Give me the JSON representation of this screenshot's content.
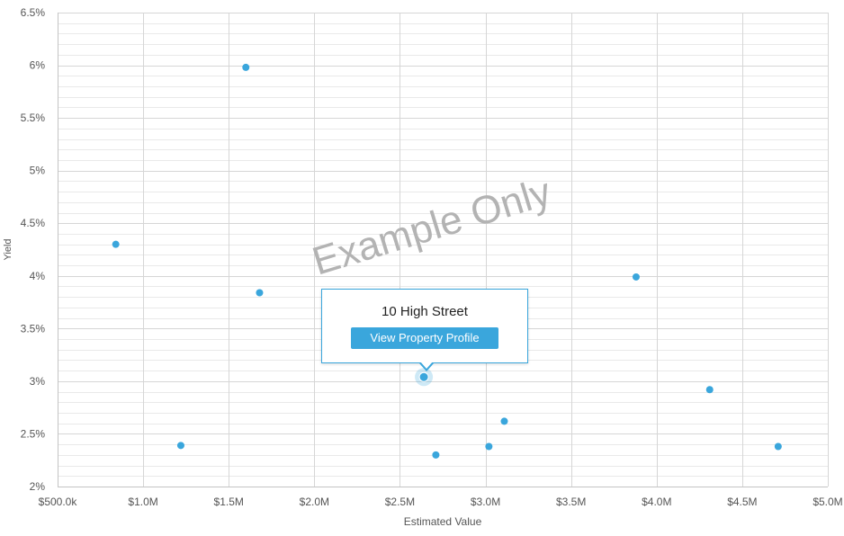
{
  "chart_data": {
    "type": "scatter",
    "xlabel": "Estimated Value",
    "ylabel": "Yield",
    "xlim": [
      500000,
      5000000
    ],
    "ylim": [
      2,
      6.5
    ],
    "x_ticks": [
      {
        "value": 500000,
        "label": "$500.0k"
      },
      {
        "value": 1000000,
        "label": "$1.0M"
      },
      {
        "value": 1500000,
        "label": "$1.5M"
      },
      {
        "value": 2000000,
        "label": "$2.0M"
      },
      {
        "value": 2500000,
        "label": "$2.5M"
      },
      {
        "value": 3000000,
        "label": "$3.0M"
      },
      {
        "value": 3500000,
        "label": "$3.5M"
      },
      {
        "value": 4000000,
        "label": "$4.0M"
      },
      {
        "value": 4500000,
        "label": "$4.5M"
      },
      {
        "value": 5000000,
        "label": "$5.0M"
      }
    ],
    "y_ticks": [
      {
        "value": 2,
        "label": "2%"
      },
      {
        "value": 2.5,
        "label": "2.5%"
      },
      {
        "value": 3,
        "label": "3%"
      },
      {
        "value": 3.5,
        "label": "3.5%"
      },
      {
        "value": 4,
        "label": "4%"
      },
      {
        "value": 4.5,
        "label": "4.5%"
      },
      {
        "value": 5,
        "label": "5%"
      },
      {
        "value": 5.5,
        "label": "5.5%"
      },
      {
        "value": 6,
        "label": "6%"
      },
      {
        "value": 6.5,
        "label": "6.5%"
      }
    ],
    "grid": true,
    "minor_grid": true,
    "point_color": "#3aa6dc",
    "points": [
      {
        "x": 840000,
        "y": 4.3
      },
      {
        "x": 1220000,
        "y": 2.39
      },
      {
        "x": 1600000,
        "y": 5.98
      },
      {
        "x": 1680000,
        "y": 3.84
      },
      {
        "x": 2640000,
        "y": 3.04,
        "highlighted": true
      },
      {
        "x": 2710000,
        "y": 2.3
      },
      {
        "x": 3020000,
        "y": 2.38
      },
      {
        "x": 3110000,
        "y": 2.62
      },
      {
        "x": 3880000,
        "y": 3.99
      },
      {
        "x": 4310000,
        "y": 2.92
      },
      {
        "x": 4710000,
        "y": 2.38
      }
    ]
  },
  "watermark": "Example Only",
  "tooltip": {
    "title": "10 High Street",
    "button_label": "View Property Profile",
    "accent_color": "#3aa6dc"
  }
}
